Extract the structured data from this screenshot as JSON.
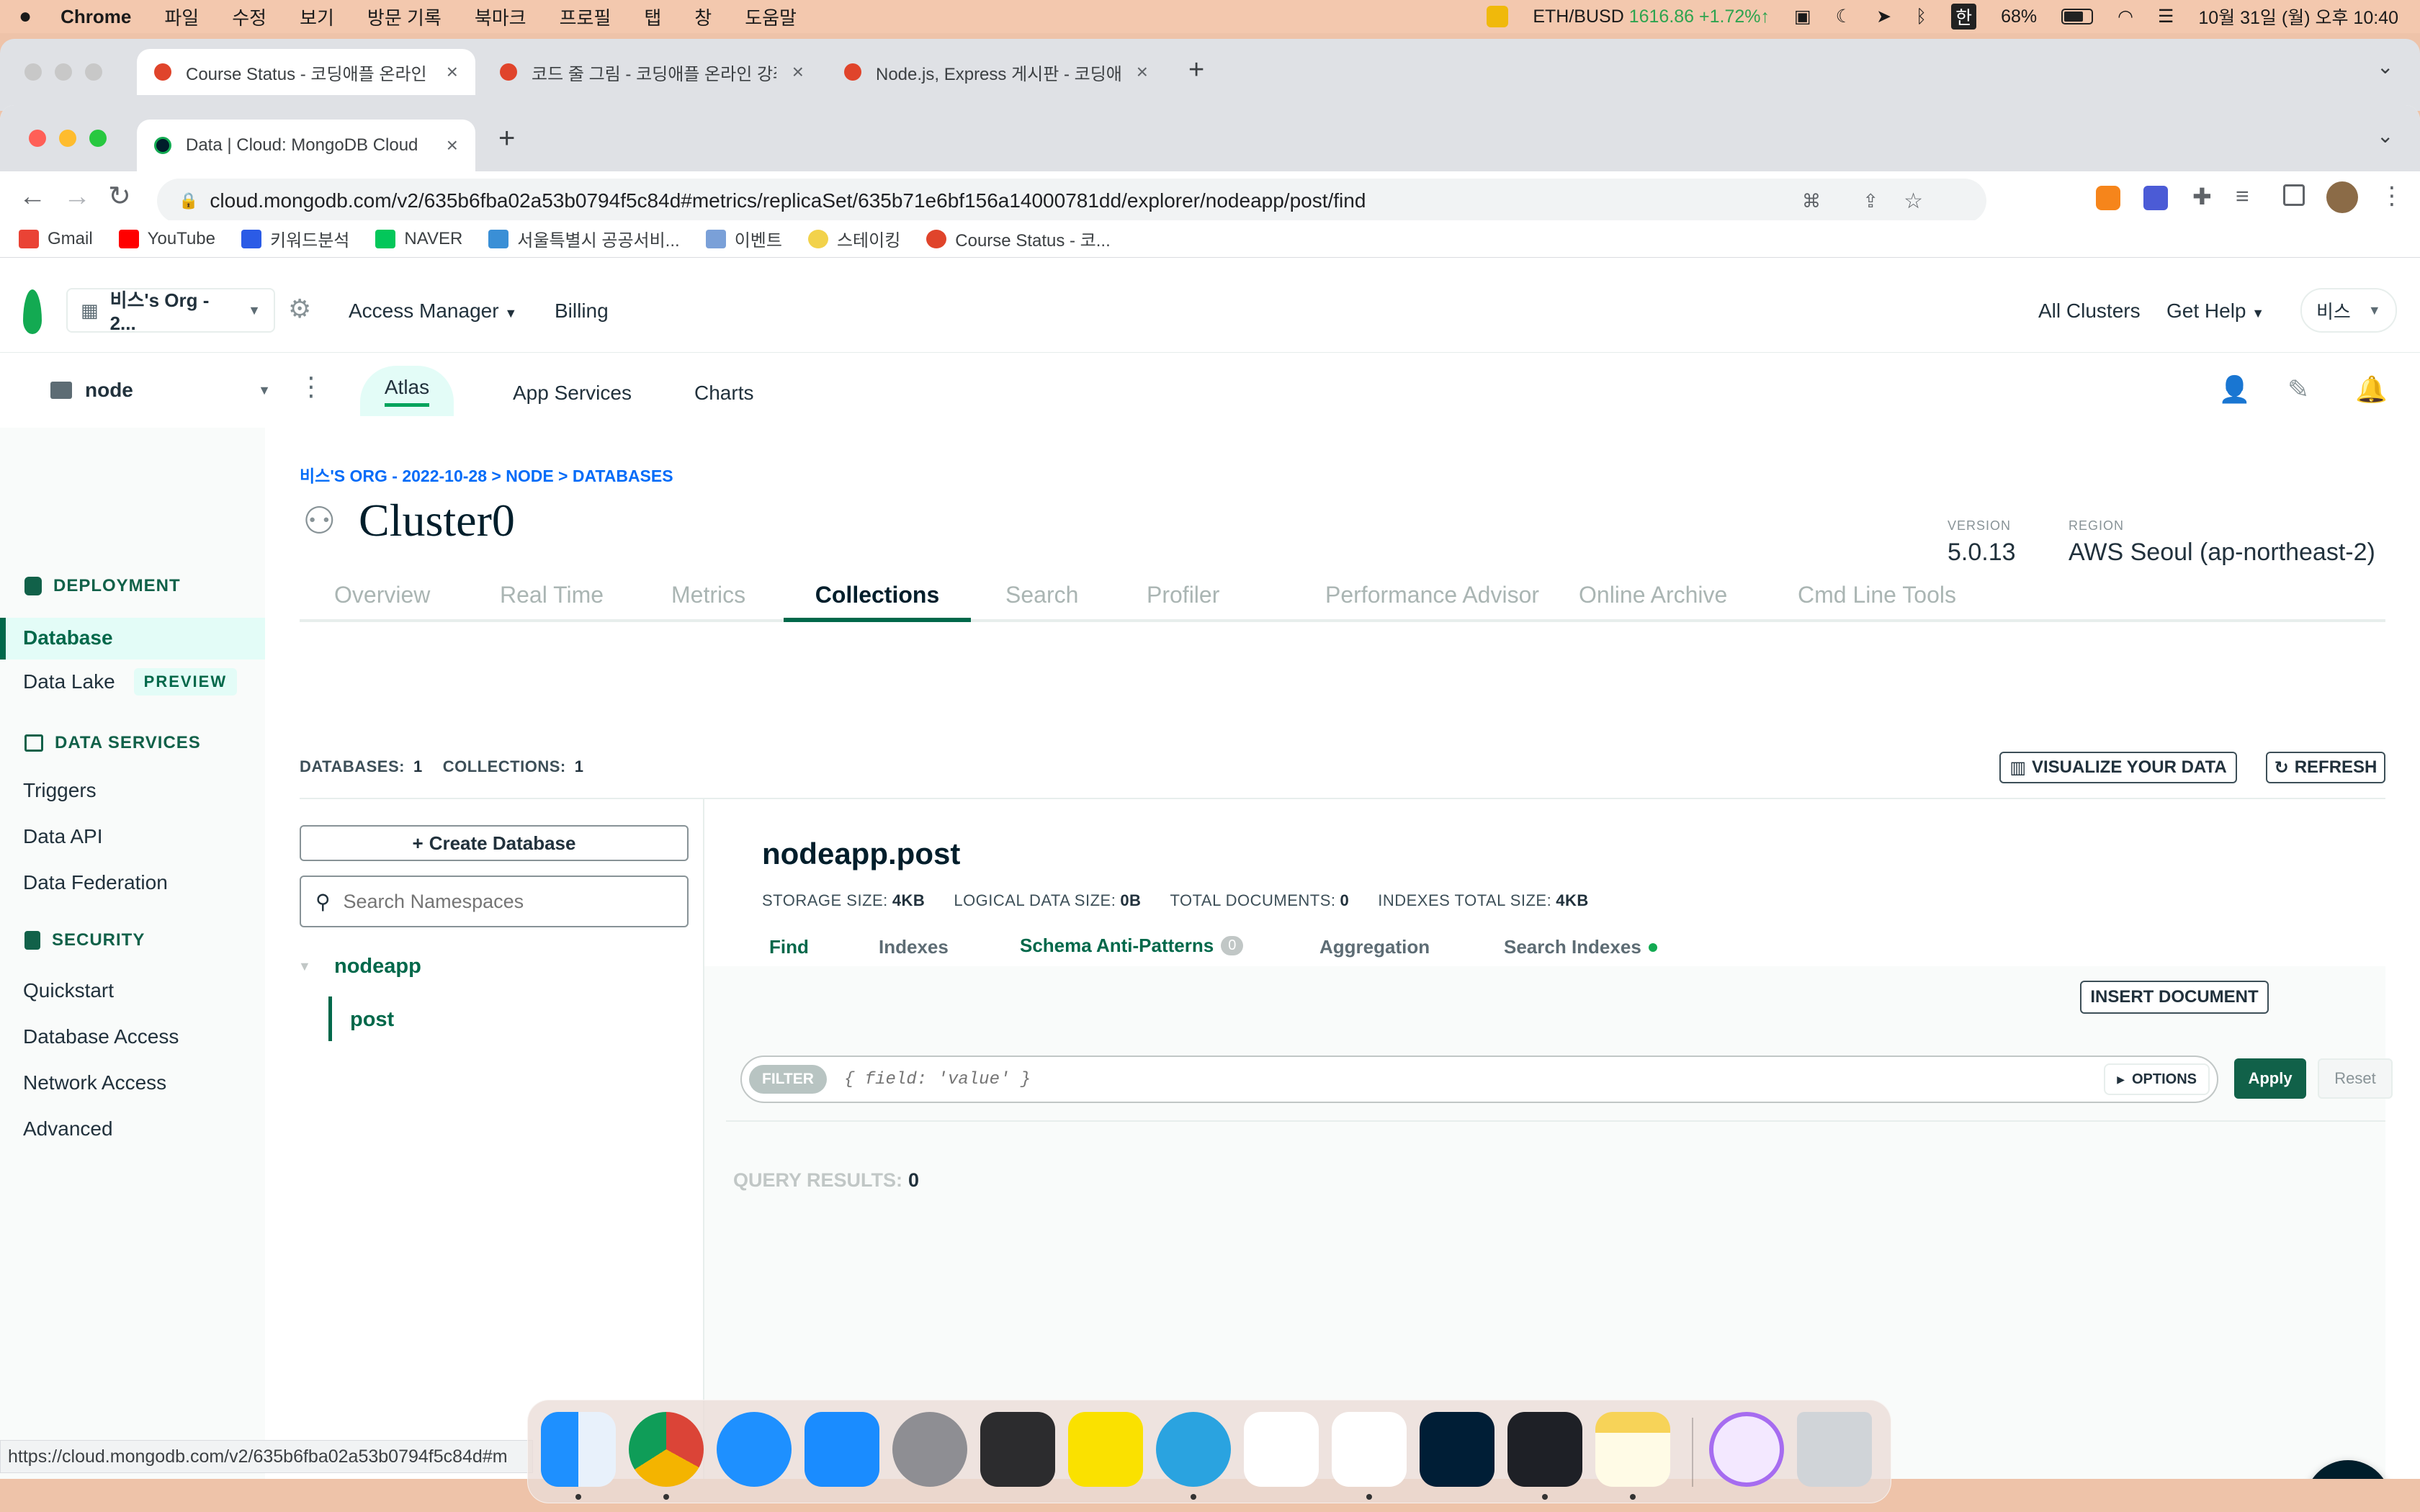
{
  "menubar": {
    "app": "Chrome",
    "items": [
      "파일",
      "수정",
      "보기",
      "방문 기록",
      "북마크",
      "프로필",
      "탭",
      "창",
      "도움말"
    ],
    "ticker_label": "ETH/BUSD",
    "ticker_price": "1616.86",
    "ticker_change": "+1.72%↑",
    "ime": "한",
    "battery": "68%",
    "datetime": "10월 31일 (월) 오후 10:40"
  },
  "back_tabs": [
    {
      "title": "Course Status - 코딩애플 온라인"
    },
    {
      "title": "코드 줄 그림 - 코딩애플 온라인 강좌"
    },
    {
      "title": "Node.js, Express 게시판 - 코딩애"
    }
  ],
  "tab": {
    "title": "Data | Cloud: MongoDB Cloud"
  },
  "url": "cloud.mongodb.com/v2/635b6fba02a53b0794f5c84d#metrics/replicaSet/635b71e6bf156a14000781dd/explorer/nodeapp/post/find",
  "bookmarks": [
    "Gmail",
    "YouTube",
    "키워드분석",
    "NAVER",
    "서울특별시 공공서비...",
    "이벤트",
    "스테이킹",
    "Course Status - 코..."
  ],
  "org": {
    "name": "비스's Org - 2...",
    "access_manager": "Access Manager",
    "billing": "Billing",
    "all_clusters": "All Clusters",
    "get_help": "Get Help",
    "user": "비스"
  },
  "project": {
    "name": "node",
    "tabs": [
      "Atlas",
      "App Services",
      "Charts"
    ]
  },
  "sidebar": {
    "deployment": "DEPLOYMENT",
    "database": "Database",
    "data_lake": "Data Lake",
    "preview": "PREVIEW",
    "data_services": "DATA SERVICES",
    "triggers": "Triggers",
    "data_api": "Data API",
    "data_federation": "Data Federation",
    "security": "SECURITY",
    "quickstart": "Quickstart",
    "database_access": "Database Access",
    "network_access": "Network Access",
    "advanced": "Advanced"
  },
  "breadcrumb": "비스'S ORG - 2022-10-28 > NODE > DATABASES",
  "cluster": {
    "name": "Cluster0",
    "version_label": "VERSION",
    "version": "5.0.13",
    "region_label": "REGION",
    "region": "AWS Seoul (ap-northeast-2)"
  },
  "cluster_tabs": [
    "Overview",
    "Real Time",
    "Metrics",
    "Collections",
    "Search",
    "Profiler",
    "Performance Advisor",
    "Online Archive",
    "Cmd Line Tools"
  ],
  "counts": {
    "databases_label": "DATABASES:",
    "databases": "1",
    "collections_label": "COLLECTIONS:",
    "collections": "1"
  },
  "buttons": {
    "visualize": "VISUALIZE YOUR DATA",
    "refresh": "REFRESH",
    "create_db": "Create Database",
    "insert": "INSERT DOCUMENT",
    "options": "OPTIONS",
    "apply": "Apply",
    "reset": "Reset"
  },
  "search": {
    "placeholder": "Search Namespaces"
  },
  "tree": {
    "db": "nodeapp",
    "collection": "post"
  },
  "collection": {
    "title": "nodeapp.post",
    "storage_label": "STORAGE SIZE:",
    "storage": "4KB",
    "logical_label": "LOGICAL DATA SIZE:",
    "logical": "0B",
    "docs_label": "TOTAL DOCUMENTS:",
    "docs": "0",
    "indexes_label": "INDEXES TOTAL SIZE:",
    "indexes": "4KB"
  },
  "coll_tabs": {
    "find": "Find",
    "indexes": "Indexes",
    "schema": "Schema Anti-Patterns",
    "schema_count": "0",
    "aggregation": "Aggregation",
    "search_indexes": "Search Indexes"
  },
  "filter": {
    "label": "FILTER",
    "placeholder": "{ field: 'value' }"
  },
  "query": {
    "label": "QUERY RESULTS:",
    "count": "0"
  },
  "statusbar": "https://cloud.mongodb.com/v2/635b6fba02a53b0794f5c84d#m",
  "colors": {
    "green": "#00684a",
    "mint": "#e3fcf7",
    "leaf": "#13aa52"
  }
}
